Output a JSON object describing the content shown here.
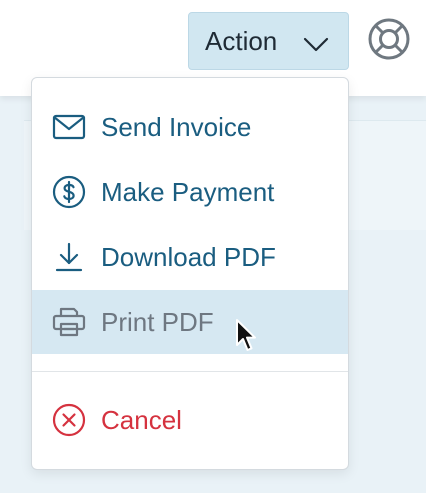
{
  "toolbar": {
    "action_label": "Action",
    "action_icon": "chevron-down-icon",
    "help_icon": "lifebuoy-icon"
  },
  "menu": {
    "items": [
      {
        "label": "Send Invoice",
        "icon": "envelope-icon"
      },
      {
        "label": "Make Payment",
        "icon": "dollar-circle-icon"
      },
      {
        "label": "Download PDF",
        "icon": "download-icon"
      },
      {
        "label": "Print PDF",
        "icon": "printer-icon",
        "state": "hovered"
      },
      {
        "label": "Cancel",
        "icon": "x-circle-icon"
      }
    ]
  },
  "colors": {
    "accent_blue": "#1a5d80",
    "hover_bg": "#d6e8f2",
    "danger": "#d5323f",
    "button_bg": "#d1e7f1"
  }
}
